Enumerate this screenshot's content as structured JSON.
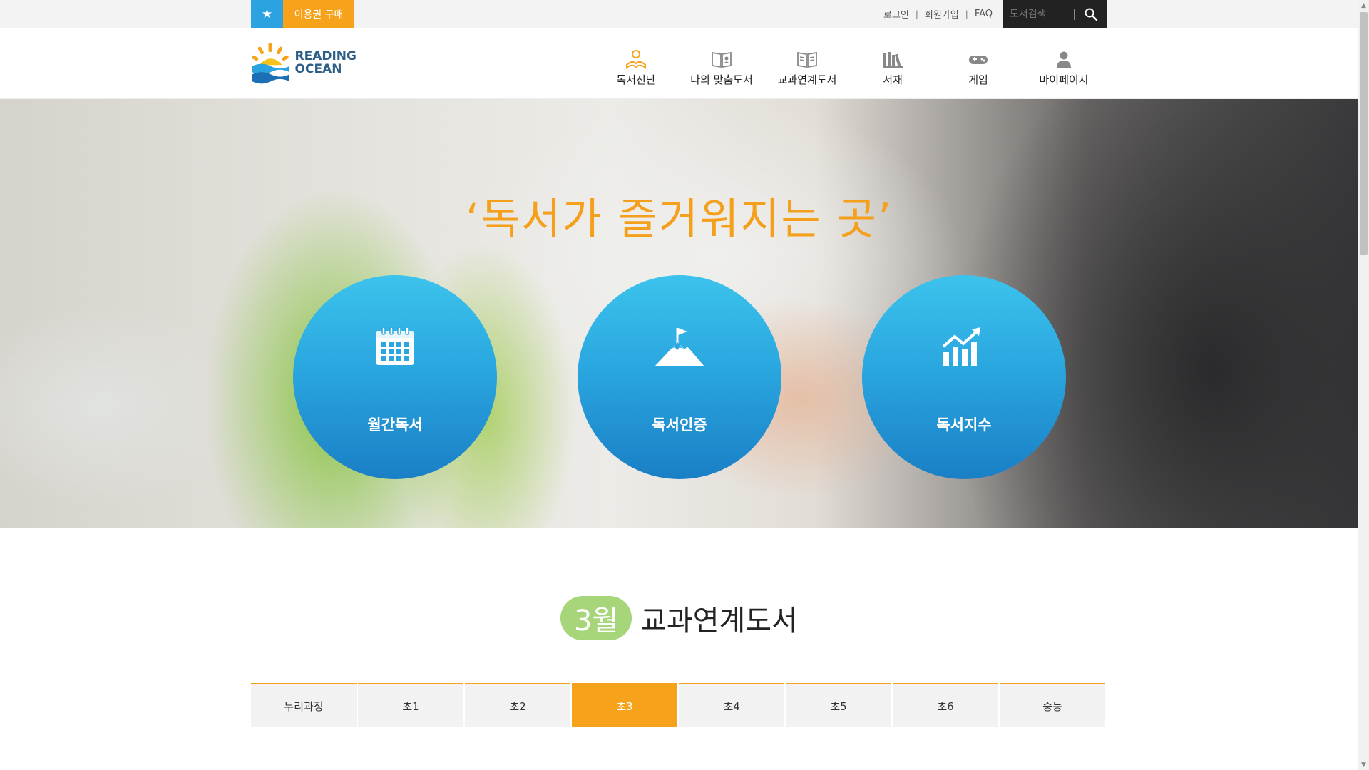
{
  "topbar": {
    "buy_star": "★",
    "buy_label": "이용권 구매",
    "login": "로그인",
    "signup": "회원가입",
    "faq": "FAQ",
    "separator": "|",
    "search_placeholder": "도서검색"
  },
  "logo": {
    "line1": "READING",
    "line2": "OCEAN"
  },
  "nav": {
    "items": [
      {
        "label": "독서진단",
        "icon": "reading-person-icon"
      },
      {
        "label": "나의 맞춤도서",
        "icon": "book-profile-icon"
      },
      {
        "label": "교과연계도서",
        "icon": "open-book-icon"
      },
      {
        "label": "서재",
        "icon": "bookshelf-icon"
      },
      {
        "label": "게임",
        "icon": "gamepad-icon"
      },
      {
        "label": "마이페이지",
        "icon": "user-icon"
      }
    ]
  },
  "hero": {
    "title": "‘독서가 즐거워지는 곳’",
    "circles": [
      {
        "label": "월간독서",
        "icon": "calendar-icon"
      },
      {
        "label": "독서인증",
        "icon": "mountain-flag-icon"
      },
      {
        "label": "독서지수",
        "icon": "growth-chart-icon"
      }
    ]
  },
  "section": {
    "month": "3월",
    "title": "교과연계도서"
  },
  "tabs": {
    "items": [
      "누리과정",
      "초1",
      "초2",
      "초3",
      "초4",
      "초5",
      "초6",
      "중등"
    ],
    "active": "초3"
  },
  "colors": {
    "accent_orange": "#f7a21b",
    "accent_blue": "#2aa3e0",
    "badge_green": "#a6d57a"
  }
}
